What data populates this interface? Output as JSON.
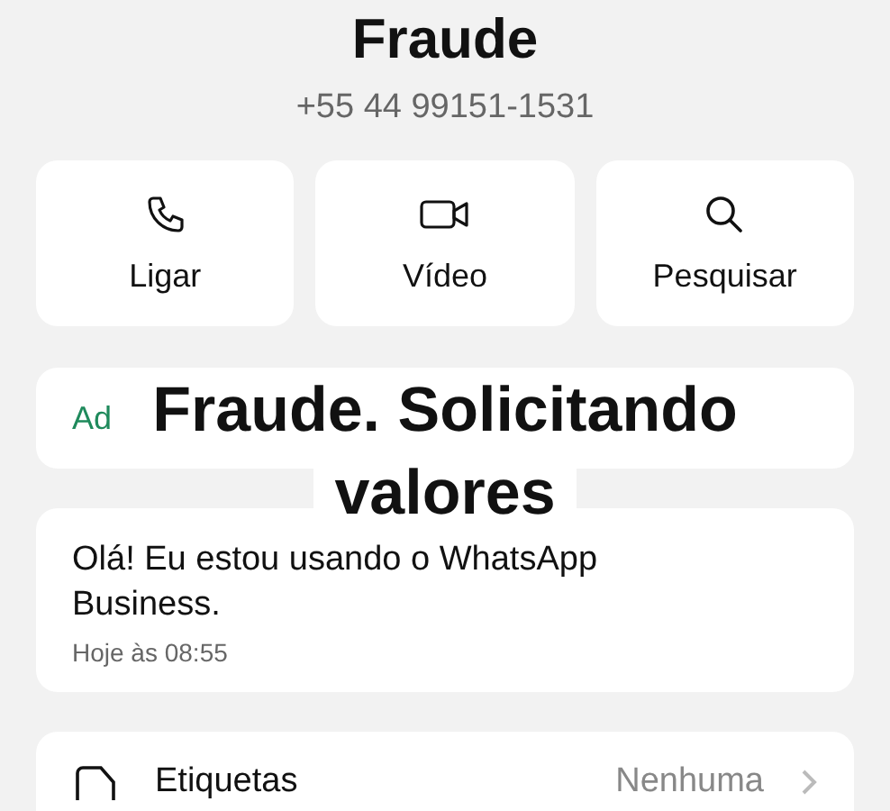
{
  "contact": {
    "name": "Fraude",
    "phone": "+55 44 99151-1531"
  },
  "actions": [
    {
      "kind": "call",
      "label": "Ligar"
    },
    {
      "kind": "video",
      "label": "Vídeo"
    },
    {
      "kind": "search",
      "label": "Pesquisar"
    }
  ],
  "partial_row": {
    "label": "Ad"
  },
  "caption": {
    "lines": [
      "Fraude. Solicitando",
      "valores"
    ]
  },
  "about": {
    "text": "Olá! Eu estou usando o WhatsApp Business.",
    "time": "Hoje às 08:55"
  },
  "labels_row": {
    "label": "Etiquetas",
    "value": "Nenhuma"
  }
}
